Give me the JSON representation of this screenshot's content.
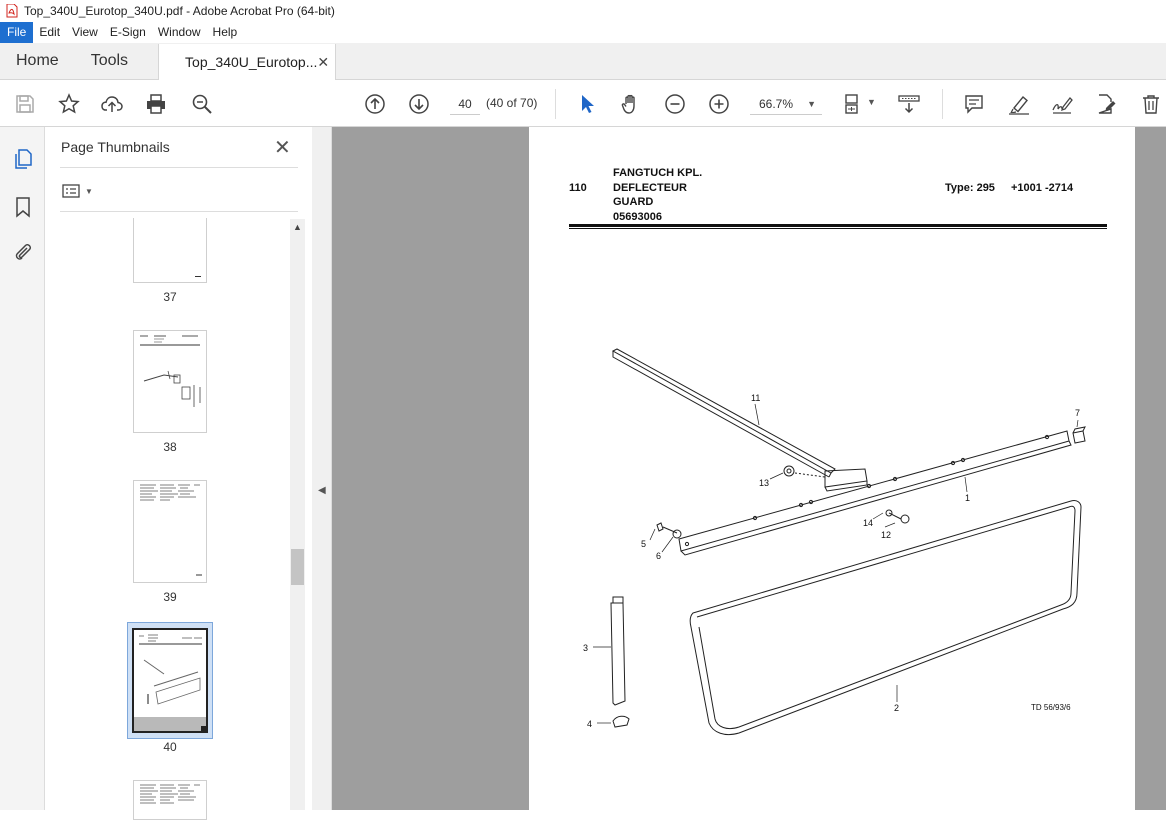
{
  "window": {
    "title": "Top_340U_Eurotop_340U.pdf - Adobe Acrobat Pro (64-bit)"
  },
  "menu": [
    "File",
    "Edit",
    "View",
    "E-Sign",
    "Window",
    "Help"
  ],
  "tabs": {
    "home": "Home",
    "tools": "Tools",
    "document": "Top_340U_Eurotop...",
    "close": "✕"
  },
  "toolbar": {
    "page_number": "40",
    "page_count": "(40 of 70)",
    "zoom": "66.7%",
    "icons": [
      "save-icon",
      "bookmark-star-icon",
      "upload-icon",
      "print-icon",
      "zoom-search-icon",
      "page-up-icon",
      "page-down-icon",
      "select-cursor-icon",
      "hand-icon",
      "zoom-out-icon",
      "zoom-in-icon",
      "page-fit-icon",
      "scroll-mode-icon",
      "comment-icon",
      "highlight-icon",
      "sign-icon",
      "edit-pdf-icon",
      "delete-icon"
    ]
  },
  "panel": {
    "title": "Page Thumbnails",
    "close": "✕",
    "thumbnails": [
      {
        "label": "37"
      },
      {
        "label": "38"
      },
      {
        "label": "39"
      },
      {
        "label": "40",
        "selected": true
      }
    ]
  },
  "document": {
    "position": "110",
    "title_de": "FANGTUCH KPL.",
    "title_fr": "DEFLECTEUR",
    "title_en": "GUARD",
    "part_number": "05693006",
    "type": "Type: 295",
    "serial": "+1001 -2714",
    "drawing_ref": "TD 56/93/6",
    "callouts": [
      "11",
      "7",
      "13",
      "1",
      "14",
      "12",
      "5",
      "6",
      "3",
      "2",
      "4"
    ]
  }
}
